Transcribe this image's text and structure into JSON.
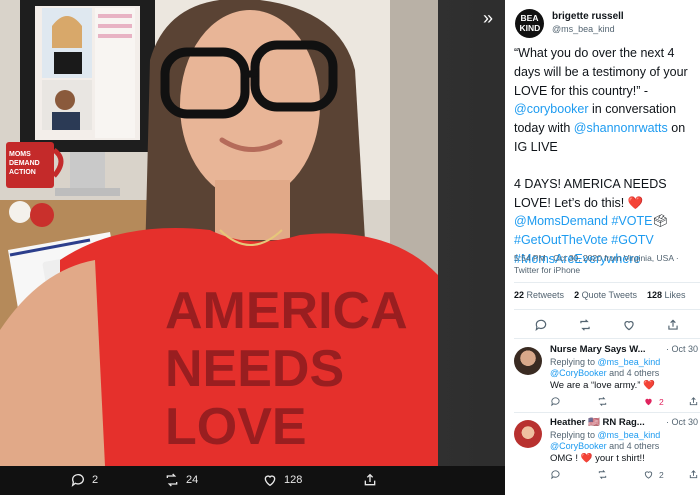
{
  "viewer": {
    "shirt_line1": "AMERICA",
    "shirt_line2": "NEEDS",
    "shirt_line3": "LOVE",
    "mug_text": "MOMS DEMAND ACTION",
    "actions": {
      "replies": "2",
      "retweets": "24",
      "likes": "128"
    }
  },
  "tweet": {
    "avatar_text": "BEA KIND",
    "name": "brigette russell",
    "handle": "@ms_bea_kind",
    "quote": "“What you do over the next 4 days will be a testimony of your LOVE for this country!” -",
    "mention_cory": "@corybooker",
    "text_in_conv": " in conversation today with ",
    "mention_shannon": "@shannonrwatts",
    "text_on_ig": " on IG LIVE",
    "line2": "4 DAYS! AMERICA NEEDS LOVE! Let’s do this!",
    "heart_emoji": "❤️",
    "mention_moms": "@MomsDemand",
    "hashtag_vote": "#VOTE",
    "ballot_emoji": "🗳",
    "hashtag_gotv_full": "#GetOutTheVote",
    "hashtag_gotv": "#GOTV",
    "hashtag_moms": "#MomsAreEverywhere",
    "time": "5:54 PM · Oct 30, 2020 from Virginia, USA · Twitter for iPhone",
    "retweets_count": "22",
    "retweets_label": "Retweets",
    "quotes_count": "2",
    "quotes_label": "Quote Tweets",
    "likes_count": "128",
    "likes_label": "Likes"
  },
  "replies": [
    {
      "name": "Nurse Mary Says W...",
      "time": "· Oct 30",
      "replying": "Replying to",
      "to_handle": "@ms_bea_kind",
      "to_rest_handle": "@CoryBooker",
      "to_rest": " and 4 others",
      "text": "We are a “love army.”",
      "heart": "❤️",
      "likes": "2"
    },
    {
      "name": "Heather 🇺🇸 RN Rag...",
      "time": "· Oct 30",
      "replying": "Replying to",
      "to_handle": "@ms_bea_kind",
      "to_rest_handle": "@CoryBooker",
      "to_rest": " and 4 others",
      "text_a": "OMG !",
      "heart": "❤️",
      "text_b": " your t shirt!!",
      "likes": "2"
    }
  ],
  "colors": {
    "shirt_red": "#e5302c",
    "link_blue": "#1d9bf0",
    "like_pink": "#e0245e"
  }
}
